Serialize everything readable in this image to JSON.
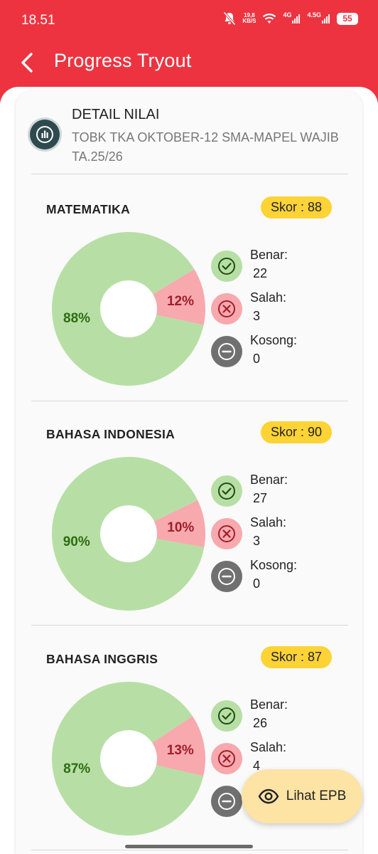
{
  "status_bar": {
    "time": "18.51",
    "net_speed_value": "19,8",
    "net_speed_unit": "KB/S",
    "net_label_1": "4G",
    "net_label_2": "4.5G",
    "battery": "55"
  },
  "app_bar": {
    "title": "Progress Tryout"
  },
  "detail": {
    "title": "DETAIL NILAI",
    "subtitle": "TOBK TKA OKTOBER-12 SMA-MAPEL WAJIB TA.25/26"
  },
  "subjects": [
    {
      "name": "MATEMATIKA",
      "score": "Skor : 88",
      "correct_pct": "88%",
      "wrong_pct": "12%",
      "correct_fraction": 0.88,
      "benar_label": "Benar:",
      "benar_value": "22",
      "salah_label": "Salah:",
      "salah_value": "3",
      "kosong_label": "Kosong:",
      "kosong_value": "0"
    },
    {
      "name": "BAHASA INDONESIA",
      "score": "Skor : 90",
      "correct_pct": "90%",
      "wrong_pct": "10%",
      "correct_fraction": 0.9,
      "benar_label": "Benar:",
      "benar_value": "27",
      "salah_label": "Salah:",
      "salah_value": "3",
      "kosong_label": "Kosong:",
      "kosong_value": "0"
    },
    {
      "name": "BAHASA INGGRIS",
      "score": "Skor : 87",
      "correct_pct": "87%",
      "wrong_pct": "13%",
      "correct_fraction": 0.87,
      "benar_label": "Benar:",
      "benar_value": "26",
      "salah_label": "Salah:",
      "salah_value": "4"
    }
  ],
  "fab": {
    "label": "Lihat EPB",
    "icon": "eye-icon"
  },
  "colors": {
    "header_red": "#ee3340",
    "correct_green": "#b7dfa5",
    "correct_text": "#2e6b12",
    "wrong_pink": "#f7a9ae",
    "wrong_text": "#a01e2a",
    "score_badge": "#fdd335",
    "empty_grey": "#707070"
  }
}
